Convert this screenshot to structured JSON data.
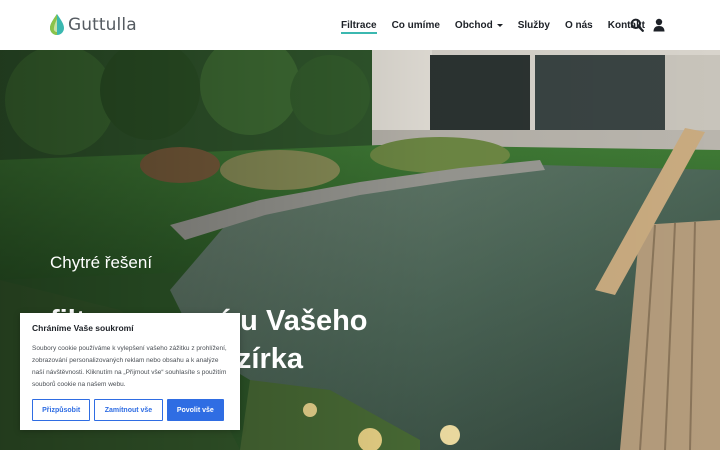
{
  "brand": {
    "name": "Guttulla",
    "icon": "water-drop-logo",
    "accent": "#3bb8b0"
  },
  "nav": {
    "items": [
      {
        "label": "Filtrace",
        "active": true
      },
      {
        "label": "Co umíme",
        "active": false
      },
      {
        "label": "Obchod",
        "active": false,
        "dropdown": true
      },
      {
        "label": "Služby",
        "active": false
      },
      {
        "label": "O nás",
        "active": false
      },
      {
        "label": "Kontakt",
        "active": false
      }
    ],
    "icons": [
      "search-icon",
      "user-icon"
    ]
  },
  "hero": {
    "kicker": "Chytré řešení",
    "title": "filtrace na míru Vašeho zahradního jezírka"
  },
  "cookie": {
    "title": "Chráníme Vaše soukromí",
    "text": "Soubory cookie používáme k vylepšení vašeho zážitku z prohlížení, zobrazování personalizovaných reklam nebo obsahu a k analýze naší návštěvnosti. Kliknutím na „Přijmout vše“ souhlasíte s použitím souborů cookie na našem webu.",
    "buttons": {
      "customize": "Přizpůsobit",
      "reject": "Zamítnout vše",
      "accept": "Povolit vše"
    },
    "accent": "#2f6de3"
  }
}
